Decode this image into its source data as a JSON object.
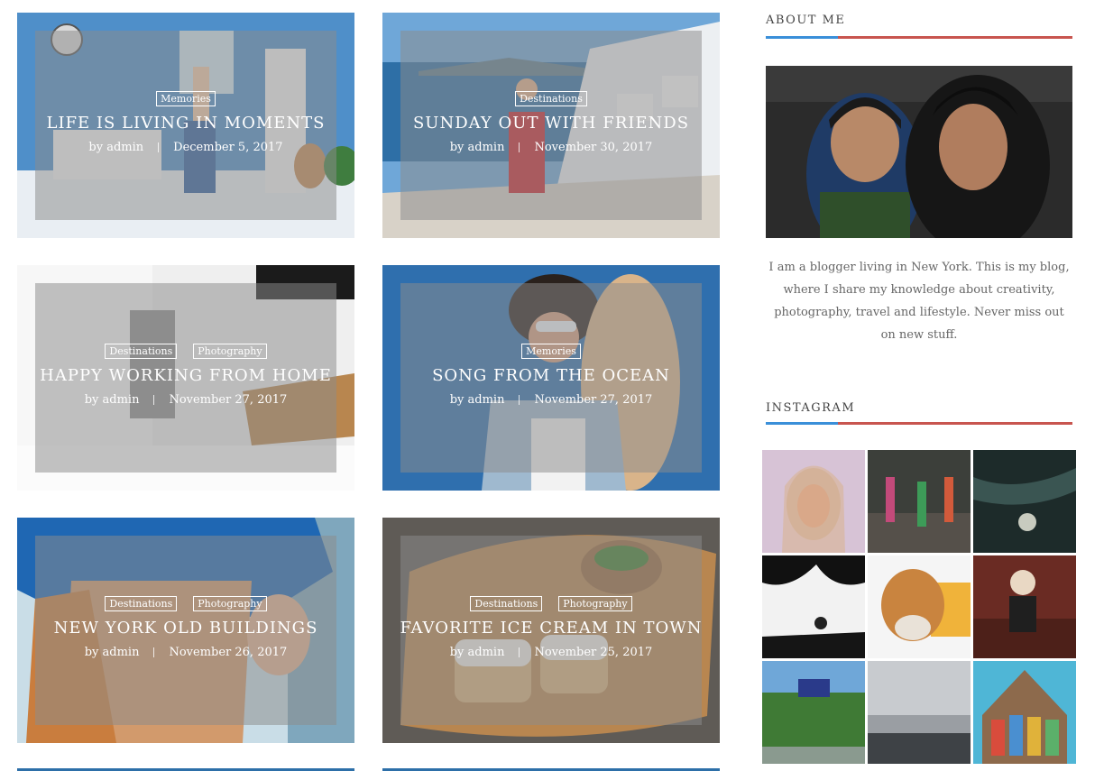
{
  "posts": [
    {
      "title": "LIFE IS LIVING IN MOMENTS",
      "categories": [
        "Memories"
      ],
      "author": "by admin",
      "date": "December 5, 2017"
    },
    {
      "title": "SUNDAY OUT WITH FRIENDS",
      "categories": [
        "Destinations"
      ],
      "author": "by admin",
      "date": "November 30, 2017"
    },
    {
      "title": "HAPPY WORKING FROM HOME",
      "categories": [
        "Destinations",
        "Photography"
      ],
      "author": "by admin",
      "date": "November 27, 2017"
    },
    {
      "title": "SONG FROM THE OCEAN",
      "categories": [
        "Memories"
      ],
      "author": "by admin",
      "date": "November 27, 2017"
    },
    {
      "title": "NEW YORK OLD BUILDINGS",
      "categories": [
        "Destinations",
        "Photography"
      ],
      "author": "by admin",
      "date": "November 26, 2017"
    },
    {
      "title": "FAVORITE ICE CREAM IN TOWN",
      "categories": [
        "Destinations",
        "Photography"
      ],
      "author": "by admin",
      "date": "November 25, 2017"
    }
  ],
  "sidebar": {
    "about_title": "ABOUT ME",
    "about_text": "I am a blogger living in New York. This is my blog, where I share my knowledge about creativity, photography, travel and lifestyle. Never miss out on new stuff.",
    "instagram_title": "INSTAGRAM"
  },
  "colors": {
    "accent_blue": "#3a8fd9",
    "accent_red": "#c8554f"
  }
}
